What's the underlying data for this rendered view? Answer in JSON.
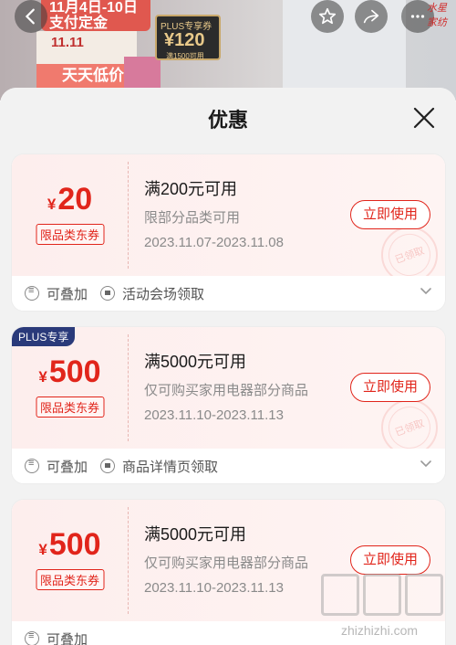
{
  "background": {
    "banner_text": "11月4日-10日 支付定金",
    "plus_coupon_title": "PLUS专享券",
    "plus_coupon_amount": "¥120",
    "plus_coupon_sub": "满1500可用",
    "event_label": "11.11",
    "daily_label": "天天低价",
    "brand": "水星家纺"
  },
  "sheet": {
    "title": "优惠"
  },
  "coupons": [
    {
      "badge": "",
      "currency": "¥",
      "amount": "20",
      "tag": "限品类东券",
      "condition": "满200元可用",
      "scope": "限部分品类可用",
      "date_range": "2023.11.07-2023.11.08",
      "button": "立即使用",
      "stamp": "已领取",
      "stackable": "可叠加",
      "source": "活动会场领取"
    },
    {
      "badge": "PLUS专享",
      "currency": "¥",
      "amount": "500",
      "tag": "限品类东券",
      "condition": "满5000元可用",
      "scope": "仅可购买家用电器部分商品",
      "date_range": "2023.11.10-2023.11.13",
      "button": "立即使用",
      "stamp": "已领取",
      "stackable": "可叠加",
      "source": "商品详情页领取"
    },
    {
      "badge": "",
      "currency": "¥",
      "amount": "500",
      "tag": "限品类东券",
      "condition": "满5000元可用",
      "scope": "仅可购买家用电器部分商品",
      "date_range": "2023.11.10-2023.11.13",
      "button": "立即使用",
      "stamp": "",
      "stackable": "可叠加",
      "source": ""
    }
  ],
  "watermark": {
    "text": "zhizhizhi.com"
  },
  "colors": {
    "accent": "#e1251b",
    "plus_badge": "#2a3a7a"
  }
}
